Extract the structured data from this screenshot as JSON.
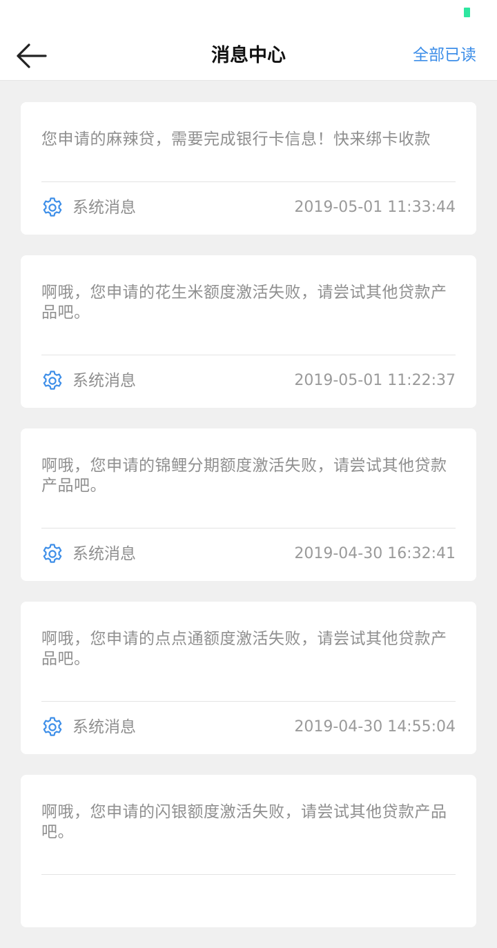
{
  "nav": {
    "title": "消息中心",
    "mark_all_read": "全部已读",
    "back_icon": "arrow-left-icon"
  },
  "colors": {
    "accent": "#3d8ee8",
    "battery": "#2ee6a0",
    "background": "#f0f0f0"
  },
  "messages": [
    {
      "content": "您申请的麻辣贷，需要完成银行卡信息！快来绑卡收款",
      "source": "系统消息",
      "time": "2019-05-01 11:33:44",
      "icon": "gear-icon"
    },
    {
      "content": "啊哦，您申请的花生米额度激活失败，请尝试其他贷款产品吧。",
      "source": "系统消息",
      "time": "2019-05-01 11:22:37",
      "icon": "gear-icon"
    },
    {
      "content": "啊哦，您申请的锦鲤分期额度激活失败，请尝试其他贷款产品吧。",
      "source": "系统消息",
      "time": "2019-04-30 16:32:41",
      "icon": "gear-icon"
    },
    {
      "content": "啊哦，您申请的点点通额度激活失败，请尝试其他贷款产品吧。",
      "source": "系统消息",
      "time": "2019-04-30 14:55:04",
      "icon": "gear-icon"
    },
    {
      "content": "啊哦，您申请的闪银额度激活失败，请尝试其他贷款产品吧。",
      "source": "",
      "time": "",
      "icon": "gear-icon"
    }
  ]
}
